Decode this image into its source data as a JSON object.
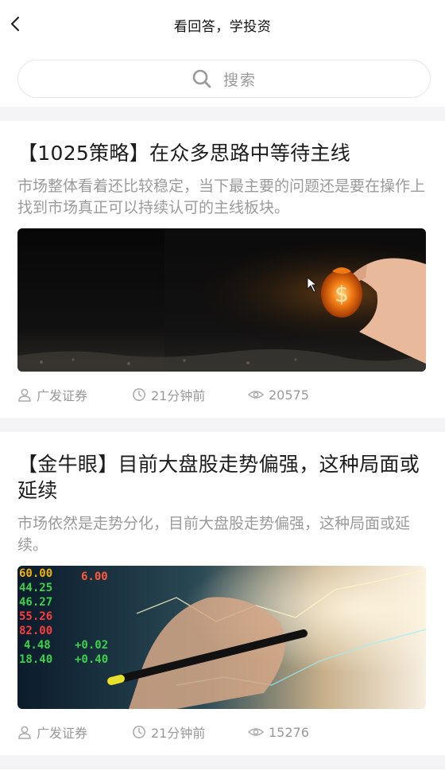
{
  "header": {
    "title": "看回答，学投资",
    "back_icon": "chevron-left-icon"
  },
  "search": {
    "placeholder": "搜索",
    "icon": "search-icon"
  },
  "articles": [
    {
      "title": "【1025策略】在众多思路中等待主线",
      "summary": "市场整体看着还比较稳定，当下最主要的问题还是要在操作上找到市场真正可以持续认可的主线板块。",
      "source": "广发证券",
      "time": "21分钟前",
      "views": "20575"
    },
    {
      "title": "【金牛眼】目前大盘股走势偏强，这种局面或延续",
      "summary": "市场依然是走势分化，目前大盘股走势偏强，这种局面或延续。",
      "source": "广发证券",
      "time": "21分钟前",
      "views": "15276",
      "image_numbers": [
        "60.00",
        "44.25",
        "46.27",
        "55.26",
        "82.00",
        "4.48",
        "18.40",
        "6.00",
        "+0.02",
        "+0.40"
      ]
    }
  ]
}
